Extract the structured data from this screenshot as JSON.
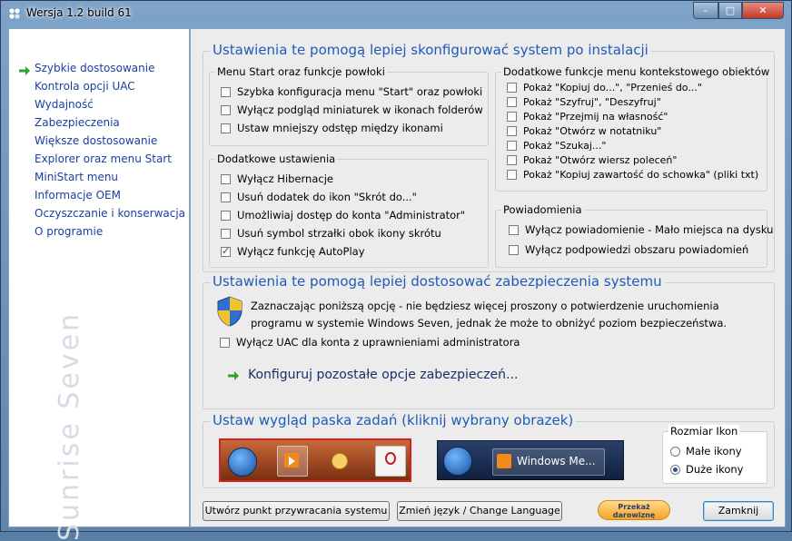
{
  "window": {
    "title": "Wersja 1.2 build 61",
    "minimize": "–",
    "maximize": "□",
    "close": "✕"
  },
  "sidebar": {
    "items": [
      {
        "label": "Szybkie dostosowanie",
        "active": true
      },
      {
        "label": "Kontrola opcji UAC"
      },
      {
        "label": "Wydajność"
      },
      {
        "label": "Zabezpieczenia"
      },
      {
        "label": "Większe dostosowanie"
      },
      {
        "label": "Explorer oraz menu Start"
      },
      {
        "label": "MiniStart menu"
      },
      {
        "label": "Informacje OEM"
      },
      {
        "label": "Oczyszczanie i konserwacja"
      },
      {
        "label": "O programie"
      }
    ],
    "watermark": "Sunrise Seven"
  },
  "section1": {
    "title": "Ustawienia te pomogą lepiej skonfigurować system po instalacji",
    "menu_start": {
      "title": "Menu Start oraz funkcje powłoki",
      "options": [
        {
          "label": "Szybka konfiguracja menu \"Start\" oraz powłoki",
          "checked": false
        },
        {
          "label": "Wyłącz podgląd miniaturek w ikonach folderów",
          "checked": false
        },
        {
          "label": "Ustaw mniejszy odstęp między ikonami",
          "checked": false
        }
      ]
    },
    "extra": {
      "title": "Dodatkowe ustawienia",
      "options": [
        {
          "label": "Wyłącz Hibernacje",
          "checked": false
        },
        {
          "label": "Usuń dodatek do ikon \"Skrót do...\"",
          "checked": false
        },
        {
          "label": "Umożliwiaj dostęp do konta \"Administrator\"",
          "checked": false
        },
        {
          "label": "Usuń symbol strzałki obok ikony skrótu",
          "checked": false
        },
        {
          "label": "Wyłącz funkcję AutoPlay",
          "checked": true
        }
      ]
    },
    "context_menu": {
      "title": "Dodatkowe funkcje menu kontekstowego obiektów",
      "options": [
        {
          "label": "Pokaż \"Kopiuj do...\", \"Przenieś do...\"",
          "checked": false
        },
        {
          "label": "Pokaż \"Szyfruj\", \"Deszyfruj\"",
          "checked": false
        },
        {
          "label": "Pokaż \"Przejmij na własność\"",
          "checked": false
        },
        {
          "label": "Pokaż \"Otwórz w notatniku\"",
          "checked": false
        },
        {
          "label": "Pokaż \"Szukaj...\"",
          "checked": false
        },
        {
          "label": "Pokaż \"Otwórz wiersz poleceń\"",
          "checked": false
        },
        {
          "label": "Pokaż \"Kopiuj zawartość do schowka\" (pliki txt)",
          "checked": false
        }
      ]
    },
    "notifications": {
      "title": "Powiadomienia",
      "options": [
        {
          "label": "Wyłącz powiadomienie - Mało miejsca na dysku",
          "checked": false
        },
        {
          "label": "Wyłącz podpowiedzi obszaru powiadomień",
          "checked": false
        }
      ]
    }
  },
  "section2": {
    "title": "Ustawienia te pomogą lepiej dostosować zabezpieczenia systemu",
    "info_line1": "Zaznaczając poniższą opcję - nie będziesz więcej proszony o potwierdzenie uruchomienia",
    "info_line2": "programu w systemie Windows Seven, jednak że może to obniżyć poziom bezpieczeństwa.",
    "uac_option": {
      "label": "Wyłącz UAC dla konta z uprawnieniami administratora",
      "checked": false
    },
    "configure_link": "Konfiguruj pozostałe opcje zabezpieczeń..."
  },
  "section3": {
    "title": "Ustaw wygląd paska zadań (kliknij wybrany obrazek)",
    "preview2_label": "Windows Me...",
    "icon_size": {
      "title": "Rozmiar Ikon",
      "options": [
        {
          "label": "Małe ikony",
          "checked": false
        },
        {
          "label": "Duże ikony",
          "checked": true
        }
      ]
    }
  },
  "footer": {
    "restore_point": "Utwórz punkt przywracania systemu",
    "change_language": "Zmień język / Change Language",
    "donate_line1": "Przekaż",
    "donate_line2": "darowiznę",
    "close": "Zamknij"
  },
  "colors": {
    "accent_title": "#1e5bb8",
    "nav_link": "#1a3fa0",
    "nav_arrow": "#2fa32f"
  }
}
